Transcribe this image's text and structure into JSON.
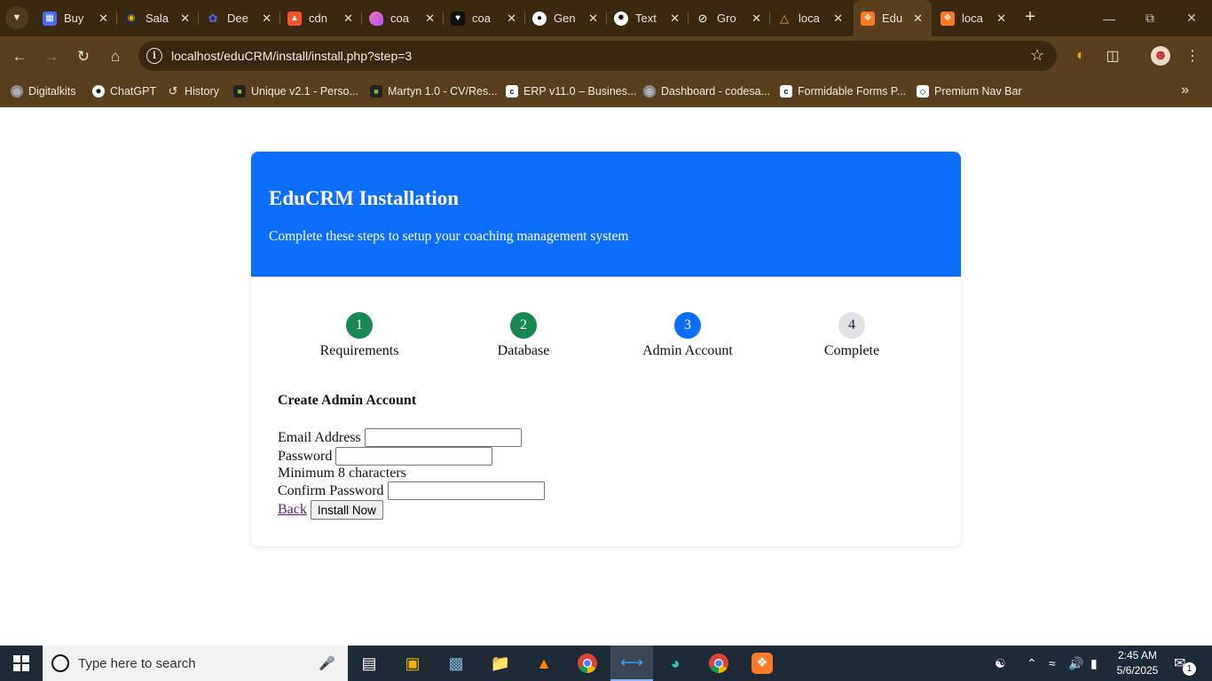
{
  "browser": {
    "tabs": [
      {
        "label": "Buy",
        "icon": "grid-icon",
        "color": "#4a6cf7"
      },
      {
        "label": "Sala",
        "icon": "ring-icon",
        "color": "#f0b400"
      },
      {
        "label": "Dee",
        "icon": "whale-icon",
        "color": "#4d6bfe"
      },
      {
        "label": "cdn",
        "icon": "shield-icon",
        "color": "#fb542b"
      },
      {
        "label": "coa",
        "icon": "blob-icon",
        "color": "#a855f7"
      },
      {
        "label": "coa",
        "icon": "heart-icon",
        "color": "#ffffff"
      },
      {
        "label": "Gen",
        "icon": "github-icon",
        "color": "#ffffff"
      },
      {
        "label": "Text",
        "icon": "openai-icon",
        "color": "#ffffff"
      },
      {
        "label": "Gro",
        "icon": "grok-icon",
        "color": "#ffffff"
      },
      {
        "label": "loca",
        "icon": "xampp-icon",
        "color": "#e8a23c"
      },
      {
        "label": "Edu",
        "icon": "xampp-icon",
        "color": "#fb7a24"
      },
      {
        "label": "loca",
        "icon": "xampp-icon",
        "color": "#fb7a24"
      }
    ],
    "url": "localhost/eduCRM/install/install.php?step=3",
    "bookmarks": [
      {
        "label": "Digitalkits",
        "icon": "globe-icon"
      },
      {
        "label": "ChatGPT",
        "icon": "openai-icon"
      },
      {
        "label": "History",
        "icon": "history-icon"
      },
      {
        "label": "Unique v2.1 - Perso...",
        "icon": "themeforest-icon"
      },
      {
        "label": "Martyn 1.0 - CV/Res...",
        "icon": "themeforest-icon"
      },
      {
        "label": "ERP v11.0 – Busines...",
        "icon": "codecanyon-icon"
      },
      {
        "label": "Dashboard - codesa...",
        "icon": "globe-icon"
      },
      {
        "label": "Formidable Forms P...",
        "icon": "codecanyon-icon"
      },
      {
        "label": "Premium Nav Bar",
        "icon": "codepen-icon"
      }
    ]
  },
  "install": {
    "title": "EduCRM Installation",
    "subtitle": "Complete these steps to setup your coaching management system",
    "steps": [
      {
        "number": "1",
        "label": "Requirements",
        "state": "done",
        "color": "#198754"
      },
      {
        "number": "2",
        "label": "Database",
        "state": "done",
        "color": "#198754"
      },
      {
        "number": "3",
        "label": "Admin Account",
        "state": "active",
        "color": "#0d6efd"
      },
      {
        "number": "4",
        "label": "Complete",
        "state": "pending",
        "color": "#dee2e6"
      }
    ],
    "form": {
      "title": "Create Admin Account",
      "email_label": "Email Address",
      "email_value": "",
      "password_label": "Password",
      "password_value": "",
      "password_hint": "Minimum 8 characters",
      "confirm_label": "Confirm Password",
      "confirm_value": "",
      "back_label": "Back",
      "install_label": "Install Now"
    },
    "header_color": "#0d6efd"
  },
  "taskbar": {
    "search_placeholder": "Type here to search",
    "time": "2:45 AM",
    "date": "5/6/2025",
    "notification_count": "1"
  }
}
